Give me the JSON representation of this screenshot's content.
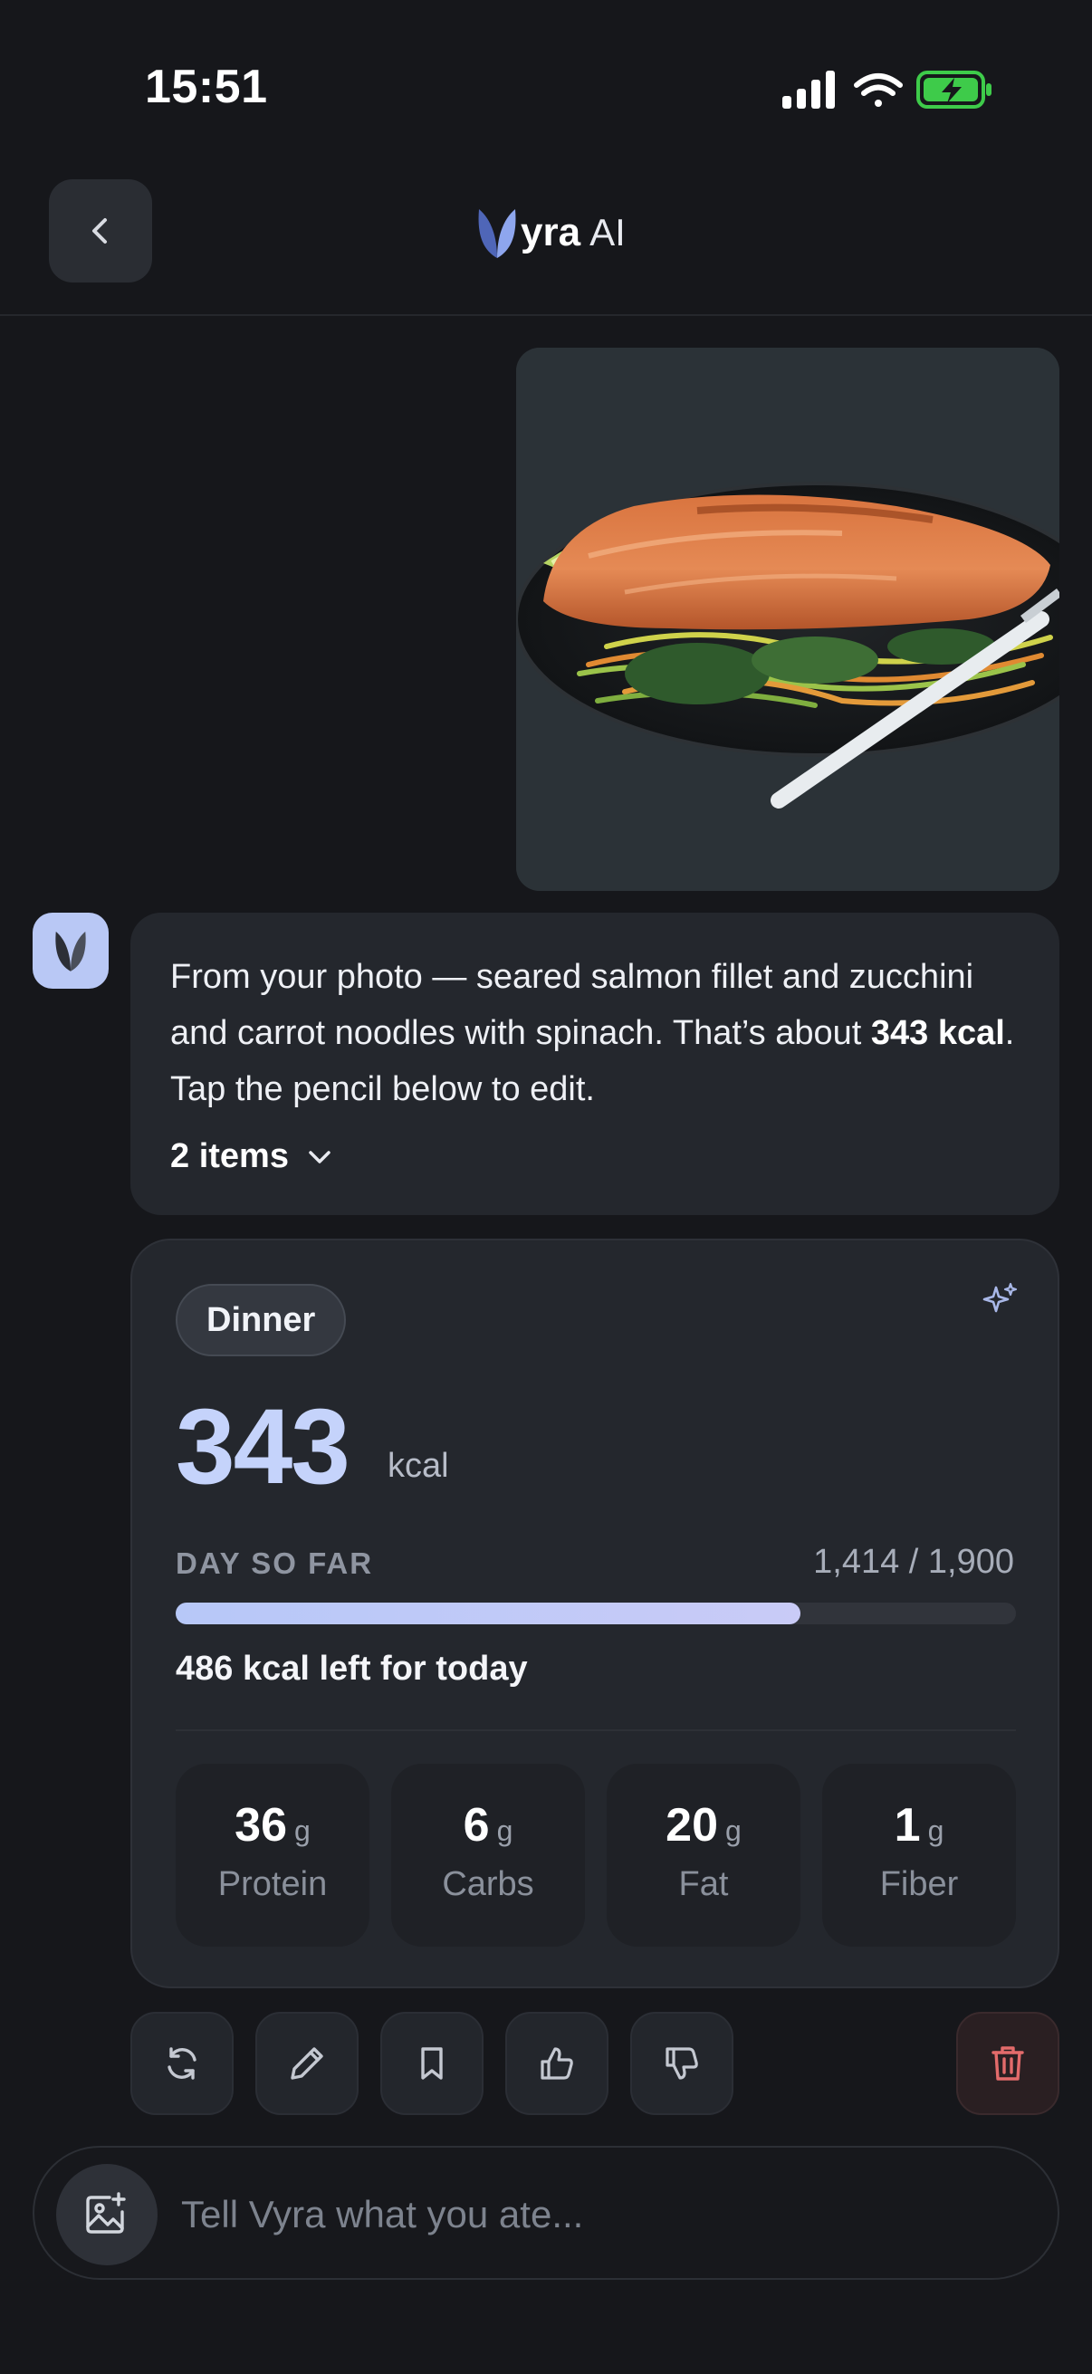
{
  "status_bar": {
    "time": "15:51",
    "battery_color": "#3ecb4a"
  },
  "header": {
    "brand_name": "yra",
    "brand_suffix": "AI",
    "back_icon": "chevron-left-icon"
  },
  "photo": {
    "subject": "seared salmon fillet with vegetable noodles"
  },
  "message": {
    "text_before": "From your photo — seared salmon fillet and zucchini and carrot noodles with spinach. That’s about ",
    "kcal_bold": "343 kcal",
    "text_after": ". Tap the pencil below to edit.",
    "items_label": "2 items"
  },
  "meal_card": {
    "meal_type": "Dinner",
    "kcal": "343",
    "kcal_unit": "kcal",
    "day_label": "DAY SO FAR",
    "day_value": "1,414 / 1,900",
    "progress": 0.744,
    "left_today": "486 kcal left for today",
    "macros": [
      {
        "value": "36",
        "unit": "g",
        "name": "Protein"
      },
      {
        "value": "6",
        "unit": "g",
        "name": "Carbs"
      },
      {
        "value": "20",
        "unit": "g",
        "name": "Fat"
      },
      {
        "value": "1",
        "unit": "g",
        "name": "Fiber"
      }
    ]
  },
  "actions": [
    "regenerate-icon",
    "pencil-icon",
    "bookmark-icon",
    "thumbs-up-icon",
    "thumbs-down-icon",
    "trash-icon"
  ],
  "composer": {
    "placeholder": "Tell Vyra what you ate..."
  },
  "colors": {
    "accent": "#c5d3fb",
    "background": "#16171b",
    "danger": "#e36b6b"
  }
}
